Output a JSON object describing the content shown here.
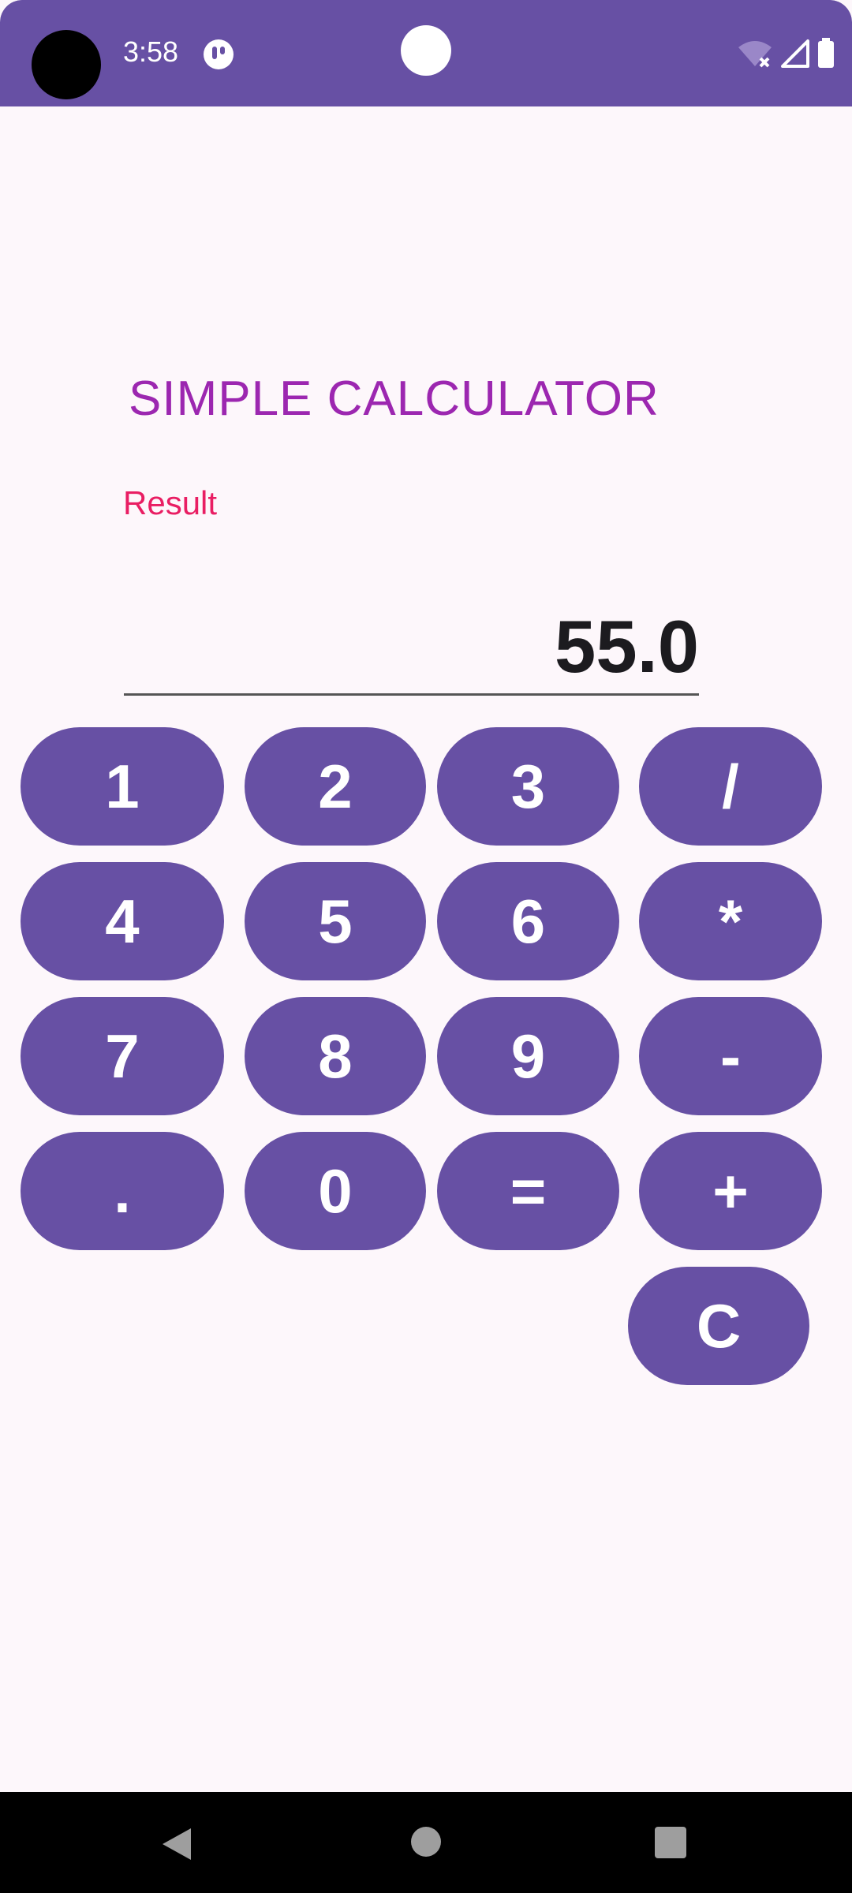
{
  "status_bar": {
    "time": "3:58",
    "icons": [
      "app-notification-icon",
      "wifi-off-icon",
      "cell-signal-icon",
      "battery-icon"
    ]
  },
  "app": {
    "title": "SIMPLE CALCULATOR",
    "result_label": "Result",
    "result_value": "55.0"
  },
  "keypad": {
    "row1": [
      "1",
      "2",
      "3",
      "/"
    ],
    "row2": [
      "4",
      "5",
      "6",
      "*"
    ],
    "row3": [
      "7",
      "8",
      "9",
      "-"
    ],
    "row4": [
      ".",
      "0",
      "=",
      "+"
    ],
    "clear": "C"
  },
  "colors": {
    "primary": "#6750a4",
    "title": "#9c27b0",
    "result_label": "#e91e63",
    "background": "#fdf7fb"
  },
  "nav_bar": {
    "icons": [
      "back-icon",
      "home-icon",
      "recents-icon"
    ]
  }
}
